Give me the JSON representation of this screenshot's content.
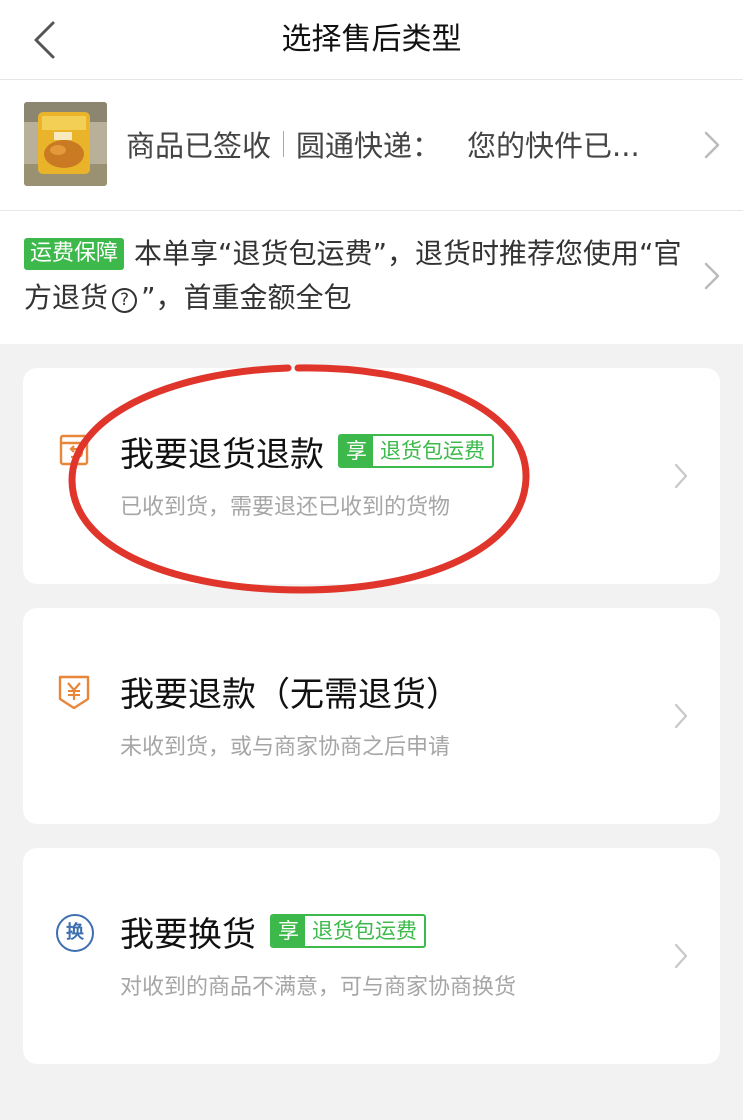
{
  "header": {
    "title": "选择售后类型",
    "back_icon": "chevron-left-icon"
  },
  "order": {
    "status_label": "商品已签收",
    "carrier": "圆通快递：",
    "tracking_status": "您的快件已..."
  },
  "shipping": {
    "badge": "运费保障",
    "text_part1": "本单享“退货包运费”，退货时推荐您使用“官方退货",
    "help_icon": "?",
    "text_part2": "”，首重金额全包"
  },
  "options": [
    {
      "title": "我要退货退款",
      "badge_tag": "享",
      "badge_text": "退货包运费",
      "subtitle": "已收到货，需要退还已收到的货物",
      "icon": "return-package-icon"
    },
    {
      "title": "我要退款（无需退货）",
      "subtitle": "未收到货，或与商家协商之后申请",
      "icon": "yuan-refund-icon"
    },
    {
      "title": "我要换货",
      "badge_tag": "享",
      "badge_text": "退货包运费",
      "subtitle": "对收到的商品不满意，可与商家协商换货",
      "icon": "exchange-icon",
      "icon_label": "换"
    }
  ],
  "colors": {
    "accent_green": "#3cb94a",
    "annotation_red": "#e0352b",
    "icon_orange": "#e8863a",
    "icon_blue": "#3e6fb0"
  }
}
